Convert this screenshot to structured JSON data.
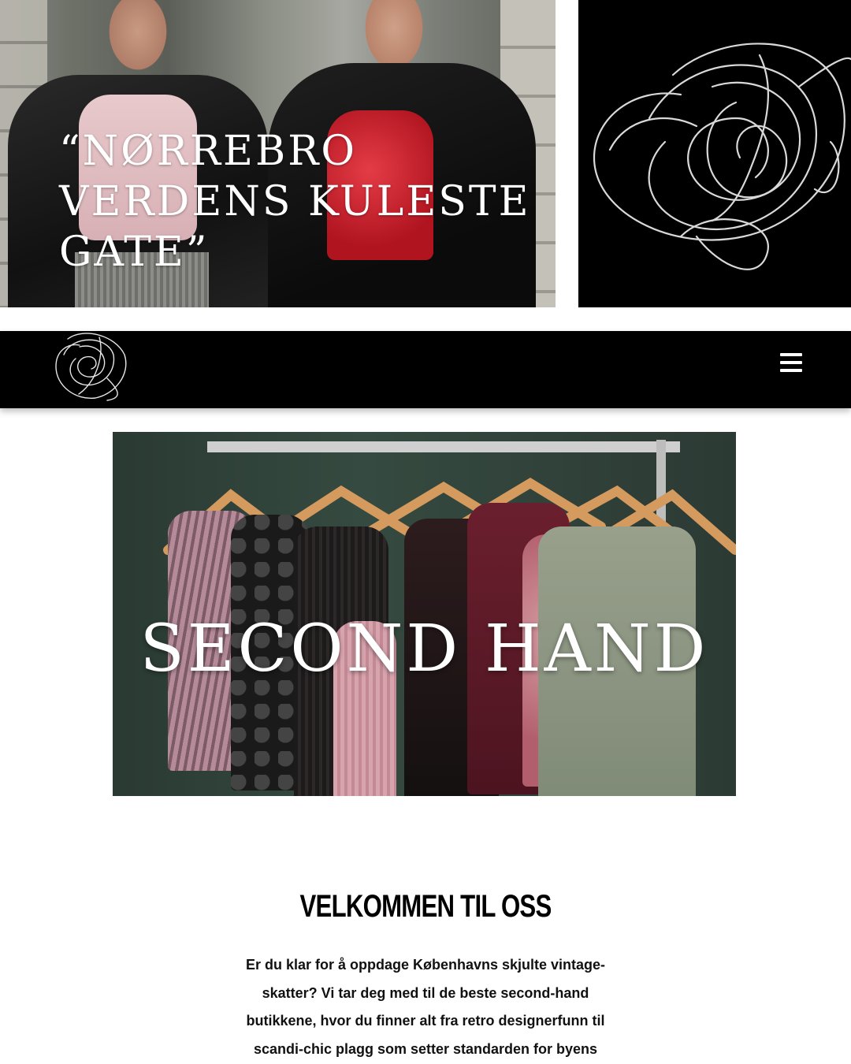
{
  "hero": {
    "quote": "“Nørrebro verdens kuleste gate”"
  },
  "nav": {
    "logo_icon": "rose-line-icon",
    "menu_icon": "hamburger-icon"
  },
  "banner": {
    "title": "Second hand"
  },
  "intro": {
    "title": "Velkommen til oss",
    "text": "Er du klar for å oppdage Københavns skjulte vintage-skatter? Vi tar deg med til de beste second-hand butikkene, hvor du finner alt fra retro designerfunn til scandi-chic plagg som setter standarden for byens"
  },
  "colors": {
    "nav_background": "#000000",
    "page_background": "#ffffff"
  }
}
